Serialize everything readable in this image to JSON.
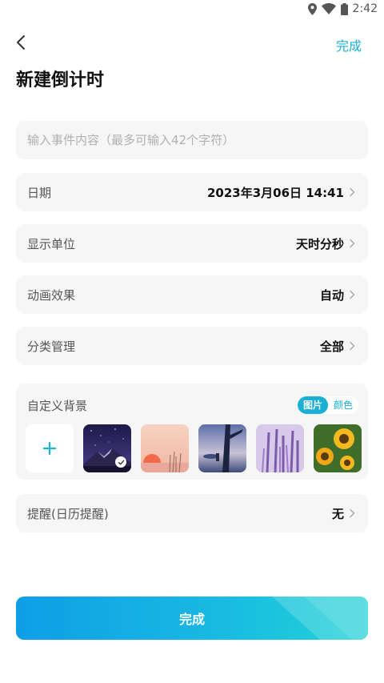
{
  "status_bar": {
    "time": "2:42"
  },
  "header": {
    "title": "新建倒计时",
    "done_label": "完成"
  },
  "event_input": {
    "placeholder": "输入事件内容（最多可输入42个字符）",
    "value": ""
  },
  "rows": {
    "date": {
      "label": "日期",
      "value": "2023年3月06日 14:41"
    },
    "unit": {
      "label": "显示单位",
      "value": "天时分秒"
    },
    "animation": {
      "label": "动画效果",
      "value": "自动"
    },
    "category": {
      "label": "分类管理",
      "value": "全部"
    }
  },
  "background": {
    "label": "自定义背景",
    "tabs": {
      "image": "图片",
      "color": "颜色",
      "selected": "图片"
    },
    "add_icon": "plus-icon",
    "thumbnails": [
      "starry-mountain",
      "sunset-grass",
      "anime-tree-lake",
      "purple-lavender",
      "sunflowers"
    ],
    "selected_index": 0
  },
  "reminder": {
    "label": "提醒(日历提醒)",
    "value": "无"
  },
  "footer": {
    "done_label": "完成"
  },
  "colors": {
    "accent": "#1ab0d6",
    "card_bg": "#f6f6f6",
    "button_start": "#0f9ee6",
    "button_end": "#23d2d6"
  }
}
